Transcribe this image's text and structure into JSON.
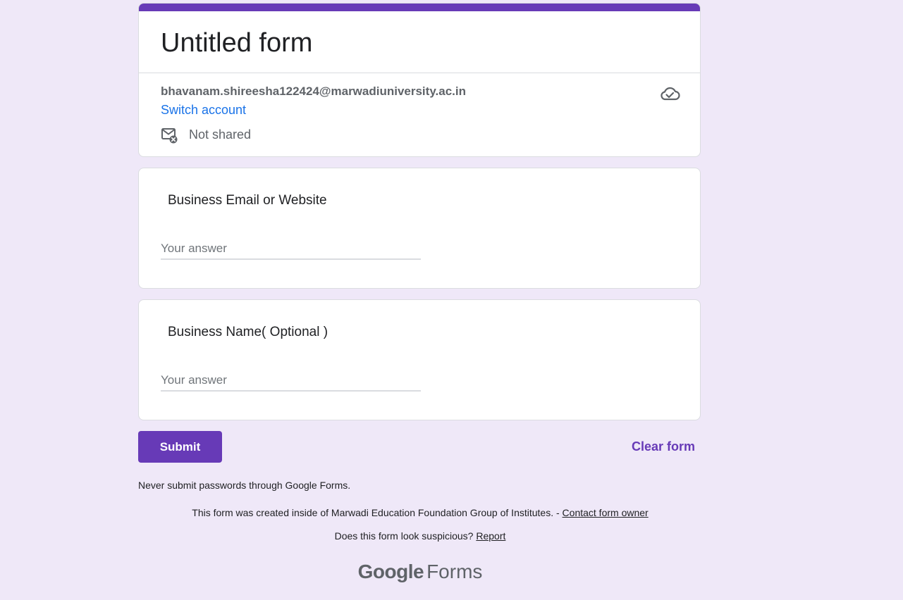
{
  "form": {
    "title": "Untitled form",
    "accent_color": "#673ab7"
  },
  "account": {
    "email": "bhavanam.shireesha122424@marwadiuniversity.ac.in",
    "switch_label": "Switch account",
    "share_status": "Not shared",
    "share_icon": "mail-not-shared-icon",
    "save_icon": "cloud-saved-icon"
  },
  "questions": [
    {
      "title": "Business Email or Website",
      "placeholder": "Your answer"
    },
    {
      "title": "Business Name( Optional )",
      "placeholder": "Your answer"
    }
  ],
  "actions": {
    "submit_label": "Submit",
    "clear_label": "Clear form"
  },
  "footer": {
    "warning": "Never submit passwords through Google Forms.",
    "created_text": "This form was created inside of Marwadi Education Foundation Group of Institutes. - ",
    "contact_label": "Contact form owner",
    "suspicious_text": "Does this form look suspicious? ",
    "report_label": "Report",
    "logo_google": "Google",
    "logo_forms": "Forms"
  }
}
